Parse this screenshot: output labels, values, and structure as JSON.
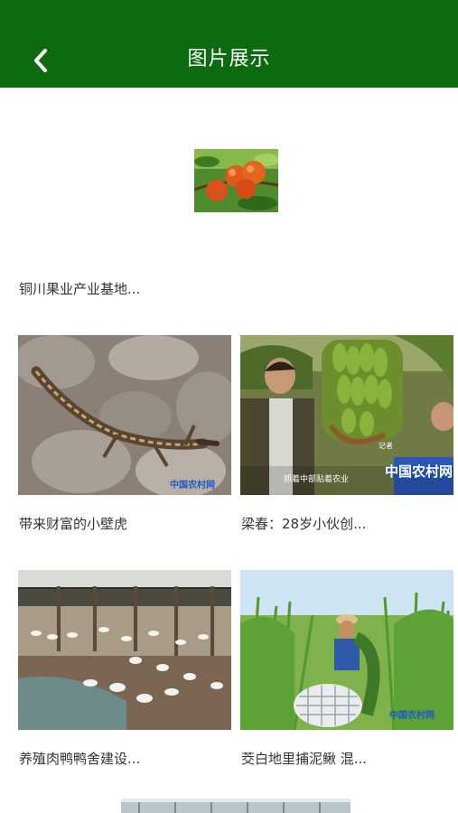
{
  "header": {
    "title": "图片展示",
    "back_icon": "chevron-left-icon",
    "color": "#0d6b0f"
  },
  "gallery": {
    "items": [
      {
        "caption": "铜川果业产业基地..."
      },
      {
        "caption": "带来财富的小壁虎",
        "watermark": "中国农村网"
      },
      {
        "caption": "梁春：28岁小伙创...",
        "watermark": "中国农村网",
        "overlay_text": "抓着中部贴着农业",
        "reporter_tag": "记者"
      },
      {
        "caption": "养殖肉鸭鸭舍建设..."
      },
      {
        "caption": "茭白地里捕泥鳅 混...",
        "watermark": "中国农村网"
      }
    ]
  }
}
